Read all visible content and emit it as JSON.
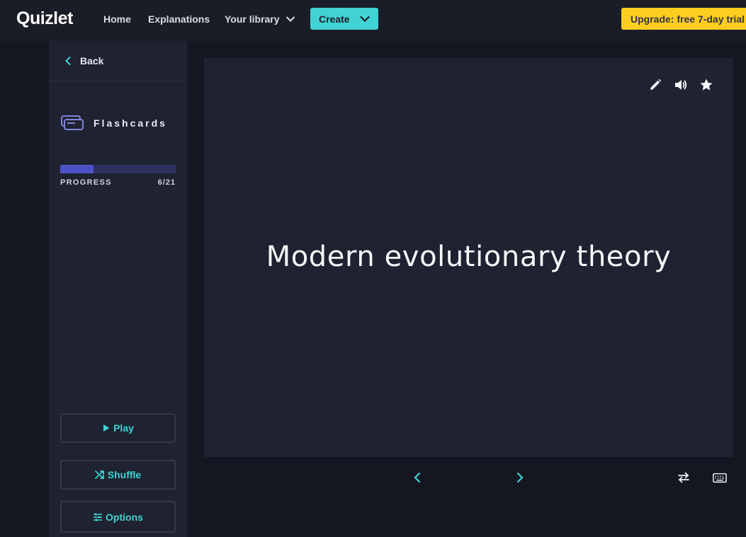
{
  "header": {
    "logo": "Quizlet",
    "nav": {
      "home": "Home",
      "explanations": "Explanations",
      "library": "Your library"
    },
    "create_label": "Create",
    "upgrade_label": "Upgrade: free 7-day trial"
  },
  "sidebar": {
    "back_label": "Back",
    "mode_label": "Flashcards",
    "progress": {
      "label": "PROGRESS",
      "count": "6/21",
      "current": 6,
      "total": 21
    },
    "buttons": {
      "play": "Play",
      "shuffle": "Shuffle",
      "options": "Options"
    }
  },
  "card": {
    "term": "Modern evolutionary theory"
  },
  "icons": {
    "edit": "pencil-icon",
    "audio": "speaker-icon",
    "star": "star-icon",
    "prev": "chevron-left-icon",
    "next": "chevron-right-icon",
    "swap": "swap-arrows-icon",
    "keyboard": "keyboard-icon"
  },
  "colors": {
    "accent": "#41d3d3",
    "upgrade": "#ffcd1f",
    "progress_fill": "#4e52c9",
    "progress_track": "#2e3160",
    "card_bg": "#1f2230",
    "page_bg": "#141622"
  }
}
